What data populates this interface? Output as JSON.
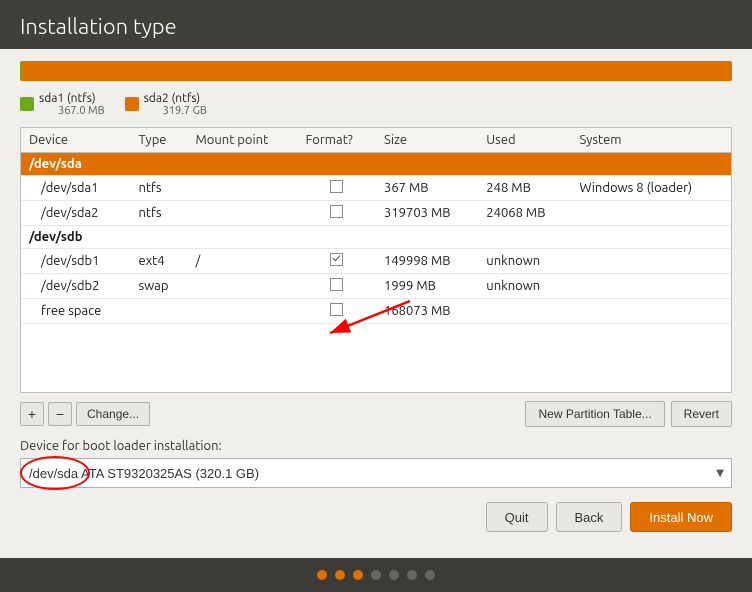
{
  "title": "Installation type",
  "partition_bar": {
    "sda1_label": "sda1 (ntfs)",
    "sda1_size": "367.0 MB",
    "sda2_label": "sda2 (ntfs)",
    "sda2_size": "319.7 GB"
  },
  "table": {
    "columns": [
      "Device",
      "Type",
      "Mount point",
      "Format?",
      "Size",
      "Used",
      "System"
    ],
    "groups": [
      {
        "group": "/dev/sda",
        "selected": true,
        "children": [
          {
            "device": "/dev/sda1",
            "type": "ntfs",
            "mount": "",
            "format": false,
            "size": "367 MB",
            "used": "248 MB",
            "system": "Windows 8 (loader)"
          },
          {
            "device": "/dev/sda2",
            "type": "ntfs",
            "mount": "",
            "format": false,
            "size": "319703 MB",
            "used": "24068 MB",
            "system": ""
          }
        ]
      },
      {
        "group": "/dev/sdb",
        "selected": false,
        "children": [
          {
            "device": "/dev/sdb1",
            "type": "ext4",
            "mount": "/",
            "format": true,
            "size": "149998 MB",
            "used": "unknown",
            "system": ""
          },
          {
            "device": "/dev/sdb2",
            "type": "swap",
            "mount": "",
            "format": false,
            "size": "1999 MB",
            "used": "unknown",
            "system": ""
          },
          {
            "device": "free space",
            "type": "",
            "mount": "",
            "format": false,
            "size": "168073 MB",
            "used": "",
            "system": ""
          }
        ]
      }
    ]
  },
  "toolbar": {
    "add_label": "+",
    "remove_label": "−",
    "change_label": "Change...",
    "new_partition_table_label": "New Partition Table...",
    "revert_label": "Revert"
  },
  "bootloader": {
    "label": "Device for boot loader installation:",
    "value": "/dev/sda",
    "description": "ATA ST9320325AS (320.1 GB)"
  },
  "buttons": {
    "quit": "Quit",
    "back": "Back",
    "install_now": "Install Now"
  },
  "dots": [
    {
      "active": true
    },
    {
      "active": true
    },
    {
      "active": true
    },
    {
      "active": false
    },
    {
      "active": false
    },
    {
      "active": false
    },
    {
      "active": false
    }
  ]
}
